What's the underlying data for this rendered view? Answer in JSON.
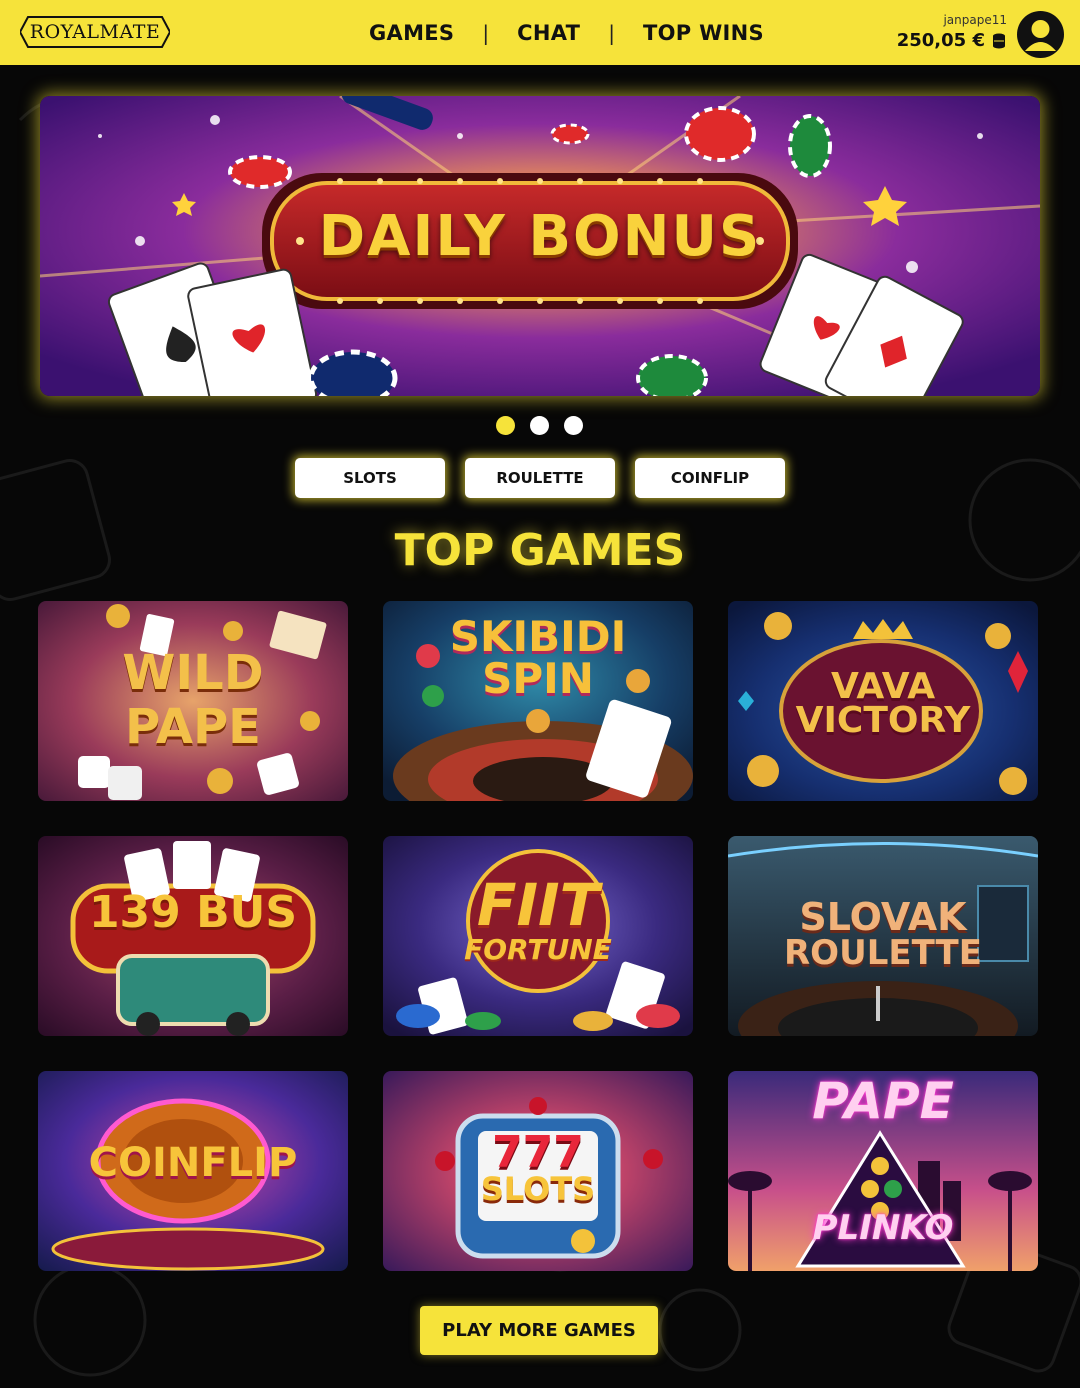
{
  "header": {
    "logo_text": "ROYALMATE",
    "nav": [
      "GAMES",
      "CHAT",
      "TOP WINS"
    ],
    "separator": "|",
    "username": "janpape11",
    "balance": "250,05 €",
    "balance_icon": "coin-stack-icon",
    "avatar_icon": "user-icon"
  },
  "banner": {
    "title": "DAILY BONUS",
    "slides_count": 3,
    "active_slide": 1
  },
  "categories": [
    "SLOTS",
    "ROULETTE",
    "COINFLIP"
  ],
  "section_title": "TOP GAMES",
  "games": [
    {
      "line1": "WILD",
      "line2": "PAPE"
    },
    {
      "line1": "SKIBIDI",
      "line2": "SPIN"
    },
    {
      "line1": "VAVA",
      "line2": "VICTORY"
    },
    {
      "line1": "139 BUS",
      "line2": ""
    },
    {
      "line1": "FIIT",
      "line2": "FORTUNE"
    },
    {
      "line1": "SLOVAK",
      "line2": "ROULETTE"
    },
    {
      "line1": "COINFLIP",
      "line2": ""
    },
    {
      "line1": "777",
      "line2": "SLOTS"
    },
    {
      "line1": "PAPE",
      "line2": "PLINKO"
    }
  ],
  "play_more": "PLAY MORE GAMES",
  "colors": {
    "accent": "#f6e33a",
    "background": "#070707"
  }
}
